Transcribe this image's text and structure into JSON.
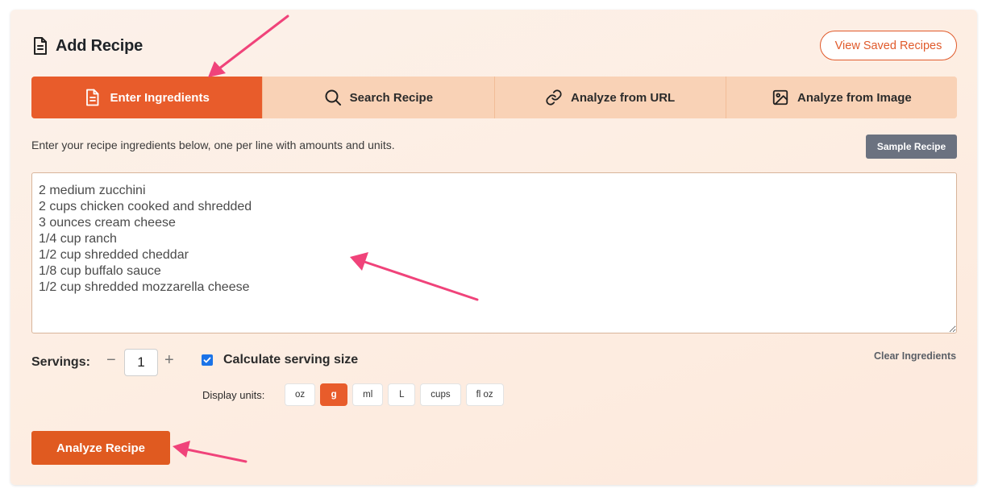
{
  "header": {
    "title": "Add Recipe",
    "view_saved_label": "View Saved Recipes"
  },
  "tabs": [
    {
      "label": "Enter Ingredients",
      "icon": "document-icon",
      "active": true
    },
    {
      "label": "Search Recipe",
      "icon": "search-icon",
      "active": false
    },
    {
      "label": "Analyze from URL",
      "icon": "link-icon",
      "active": false
    },
    {
      "label": "Analyze from Image",
      "icon": "image-icon",
      "active": false
    }
  ],
  "instructions": "Enter your recipe ingredients below, one per line with amounts and units.",
  "sample_recipe_label": "Sample Recipe",
  "ingredients_text": "2 medium zucchini\n2 cups chicken cooked and shredded\n3 ounces cream cheese\n1/4 cup ranch\n1/2 cup shredded cheddar\n1/8 cup buffalo sauce\n1/2 cup shredded mozzarella cheese",
  "servings": {
    "label": "Servings:",
    "minus": "−",
    "plus": "+",
    "value": "1"
  },
  "calculate_serving_size": {
    "label": "Calculate serving size",
    "checked": true
  },
  "clear_label": "Clear Ingredients",
  "display_units": {
    "label": "Display units:",
    "options": [
      "oz",
      "g",
      "ml",
      "L",
      "cups",
      "fl oz"
    ],
    "selected": "g"
  },
  "analyze_label": "Analyze Recipe",
  "colors": {
    "accent": "#e85c2b",
    "tab_bg": "#f9d2b6",
    "annotation_arrow": "#f0437a",
    "sample_button": "#6b7280"
  }
}
